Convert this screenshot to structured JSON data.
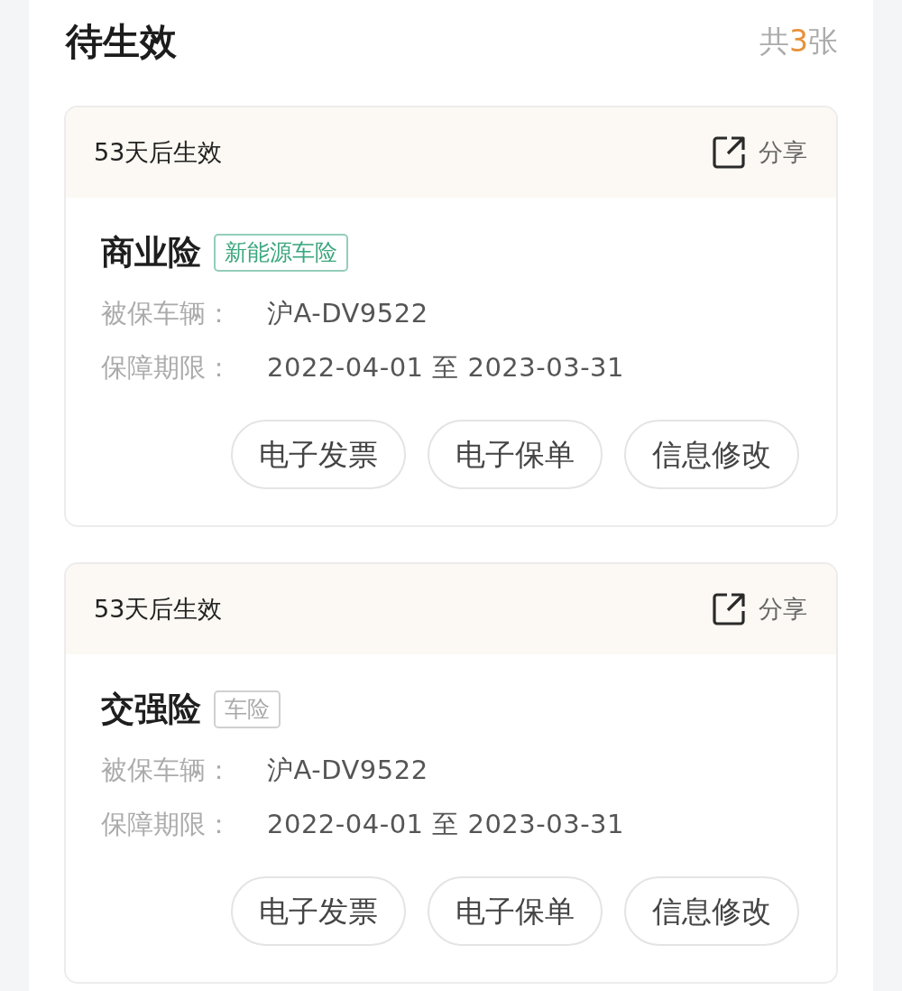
{
  "section": {
    "title": "待生效",
    "count_prefix": "共",
    "count_number": "3",
    "count_suffix": "张"
  },
  "policies": [
    {
      "status": "53天后生效",
      "share": "分享",
      "name": "商业险",
      "tag": {
        "text": "新能源车险",
        "color": "#3aa67f"
      },
      "fields": [
        {
          "label": "被保车辆：",
          "value": "沪A-DV9522"
        },
        {
          "label": "保障期限：",
          "value": "2022-04-01 至 2023-03-31"
        }
      ],
      "actions": [
        "电子发票",
        "电子保单",
        "信息修改"
      ]
    },
    {
      "status": "53天后生效",
      "share": "分享",
      "name": "交强险",
      "tag": {
        "text": "车险",
        "color": "#a9a9a9"
      },
      "fields": [
        {
          "label": "被保车辆：",
          "value": "沪A-DV9522"
        },
        {
          "label": "保障期限：",
          "value": "2022-04-01 至 2023-03-31"
        }
      ],
      "actions": [
        "电子发票",
        "电子保单",
        "信息修改"
      ]
    }
  ]
}
